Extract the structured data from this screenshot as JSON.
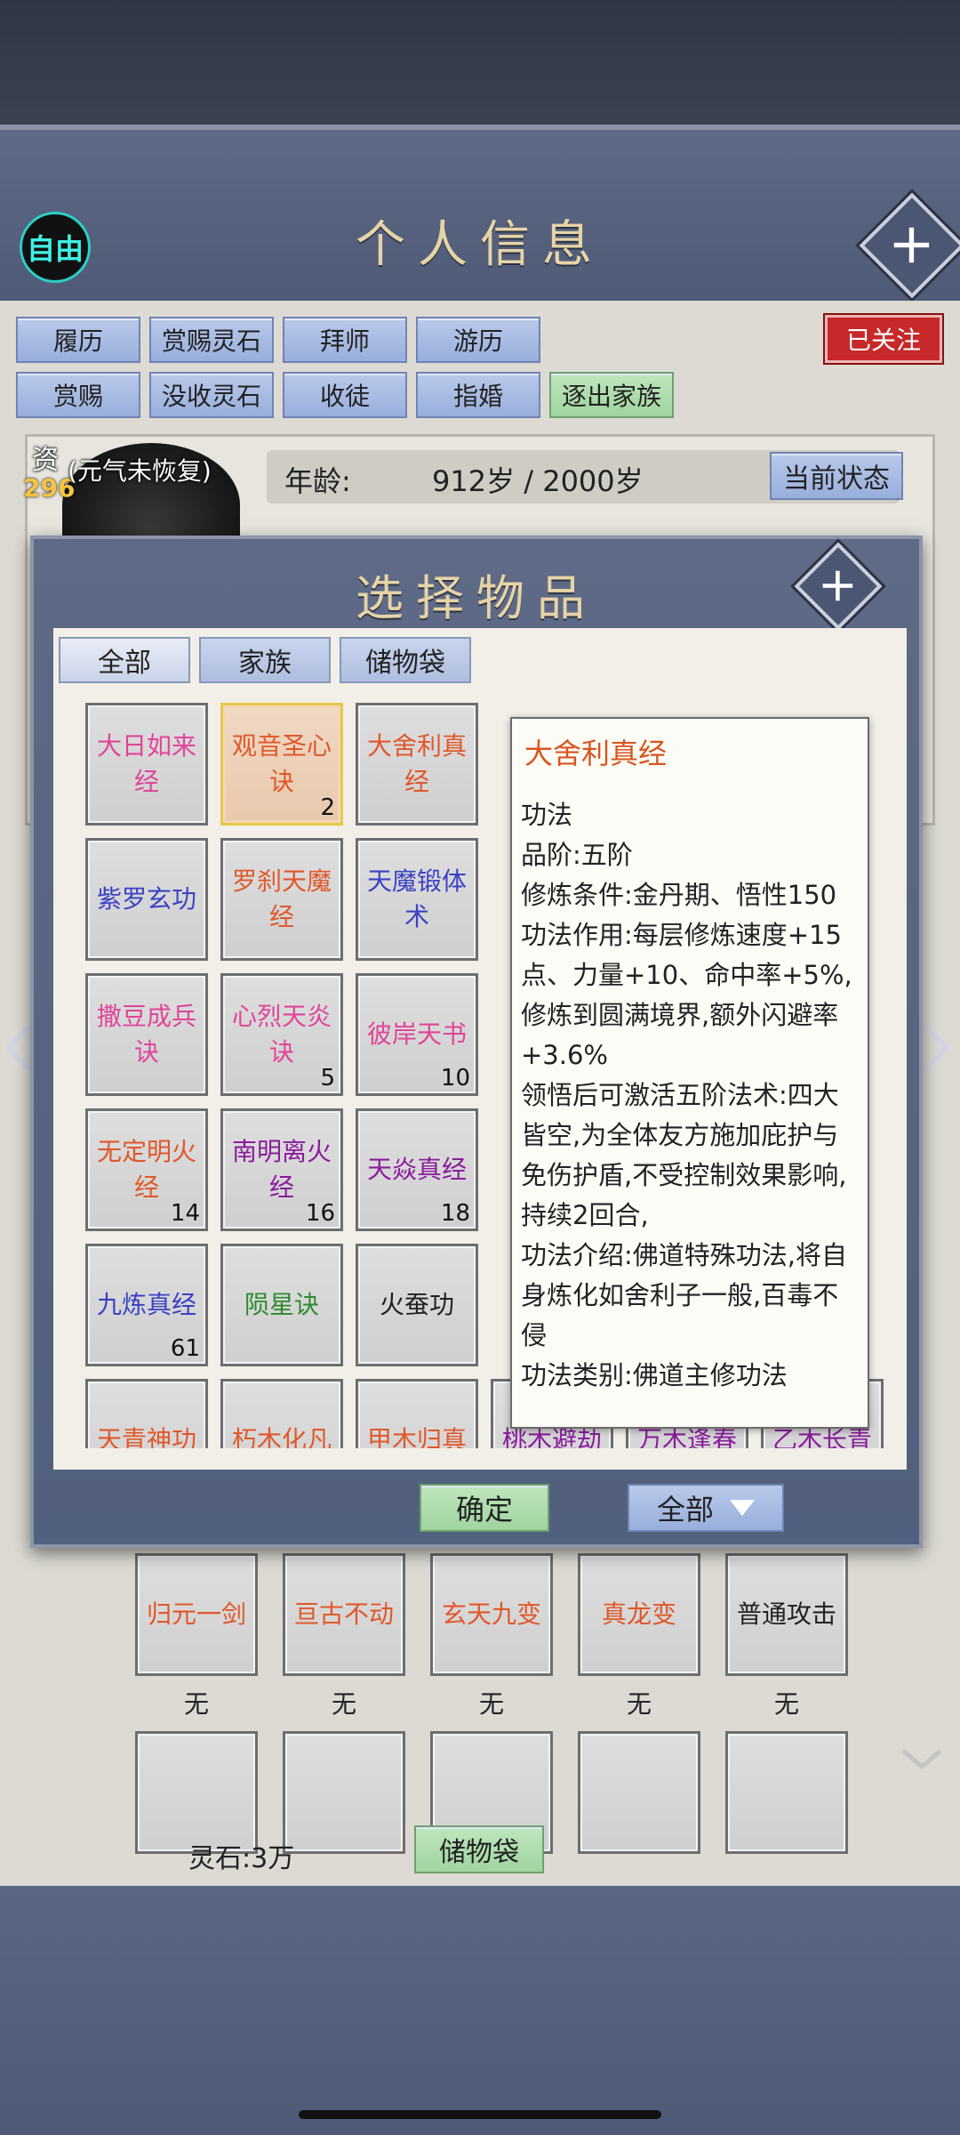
{
  "header": {
    "title": "个人信息",
    "free_label": "自由"
  },
  "action_buttons_row1": [
    "履历",
    "赏赐灵石",
    "拜师",
    "游历"
  ],
  "action_buttons_row2": [
    "赏赐",
    "没收灵石",
    "收徒",
    "指婚",
    "逐出家族"
  ],
  "followed_label": "已关注",
  "profile": {
    "zi": "资",
    "zi_value": "296",
    "vitality_note": "(元气未恢复)",
    "age_label": "年龄:",
    "age_value": "912岁 / 2000岁",
    "status_button": "当前状态"
  },
  "modal": {
    "title": "选择物品",
    "tabs": [
      "全部",
      "家族",
      "储物袋"
    ],
    "items": [
      {
        "name": "大日如来经",
        "color": "#e0459a",
        "count": ""
      },
      {
        "name": "观音圣心诀",
        "color": "#e0582a",
        "count": "2"
      },
      {
        "name": "大舍利真经",
        "color": "#e0582a",
        "count": ""
      },
      {
        "name": "紫罗玄功",
        "color": "#3b42c4",
        "count": ""
      },
      {
        "name": "罗刹天魔经",
        "color": "#e0582a",
        "count": ""
      },
      {
        "name": "天魔锻体术",
        "color": "#3b42c4",
        "count": ""
      },
      {
        "name": "撒豆成兵诀",
        "color": "#e0459a",
        "count": ""
      },
      {
        "name": "心烈天炎诀",
        "color": "#e0459a",
        "count": "5"
      },
      {
        "name": "彼岸天书",
        "color": "#e0459a",
        "count": "10"
      },
      {
        "name": "无定明火经",
        "color": "#e0582a",
        "count": "14"
      },
      {
        "name": "南明离火经",
        "color": "#8a1c9c",
        "count": "16"
      },
      {
        "name": "天焱真经",
        "color": "#8a1c9c",
        "count": "18"
      },
      {
        "name": "九炼真经",
        "color": "#3b42c4",
        "count": "61"
      },
      {
        "name": "陨星诀",
        "color": "#2e8b2e",
        "count": ""
      },
      {
        "name": "火蚕功",
        "color": "#222222",
        "count": ""
      },
      {
        "name": "天青神功",
        "color": "#e0582a",
        "count": ""
      },
      {
        "name": "朽木化凡",
        "color": "#e0582a",
        "count": ""
      },
      {
        "name": "甲木归真",
        "color": "#e0582a",
        "count": ""
      },
      {
        "name": "桃木避劫",
        "color": "#8a1c9c",
        "count": ""
      },
      {
        "name": "万木逢春",
        "color": "#8a1c9c",
        "count": ""
      },
      {
        "name": "乙木长青",
        "color": "#8a1c9c",
        "count": ""
      }
    ],
    "tooltip": {
      "title": "大舍利真经",
      "body": "功法\n品阶:五阶\n修炼条件:金丹期、悟性150\n功法作用:每层修炼速度+15点、力量+10、命中率+5%,修炼到圆满境界,额外闪避率+3.6%\n领悟后可激活五阶法术:四大皆空,为全体友方施加庇护与免伤护盾,不受控制效果影响,持续2回合,\n功法介绍:佛道特殊功法,将自身炼化如舍利子一般,百毒不侵\n功法类别:佛道主修功法"
    },
    "confirm_label": "确定",
    "filter_label": "全部"
  },
  "skills": [
    {
      "name": "归元一剑",
      "color": "#e0582a",
      "slot": "无"
    },
    {
      "name": "亘古不动",
      "color": "#e0582a",
      "slot": "无"
    },
    {
      "name": "玄天九变",
      "color": "#e0582a",
      "slot": "无"
    },
    {
      "name": "真龙变",
      "color": "#e0582a",
      "slot": "无"
    },
    {
      "name": "普通攻击",
      "color": "#222222",
      "slot": "无"
    }
  ],
  "footer": {
    "spirit_stone": "灵石:3万",
    "storage_label": "储物袋"
  }
}
